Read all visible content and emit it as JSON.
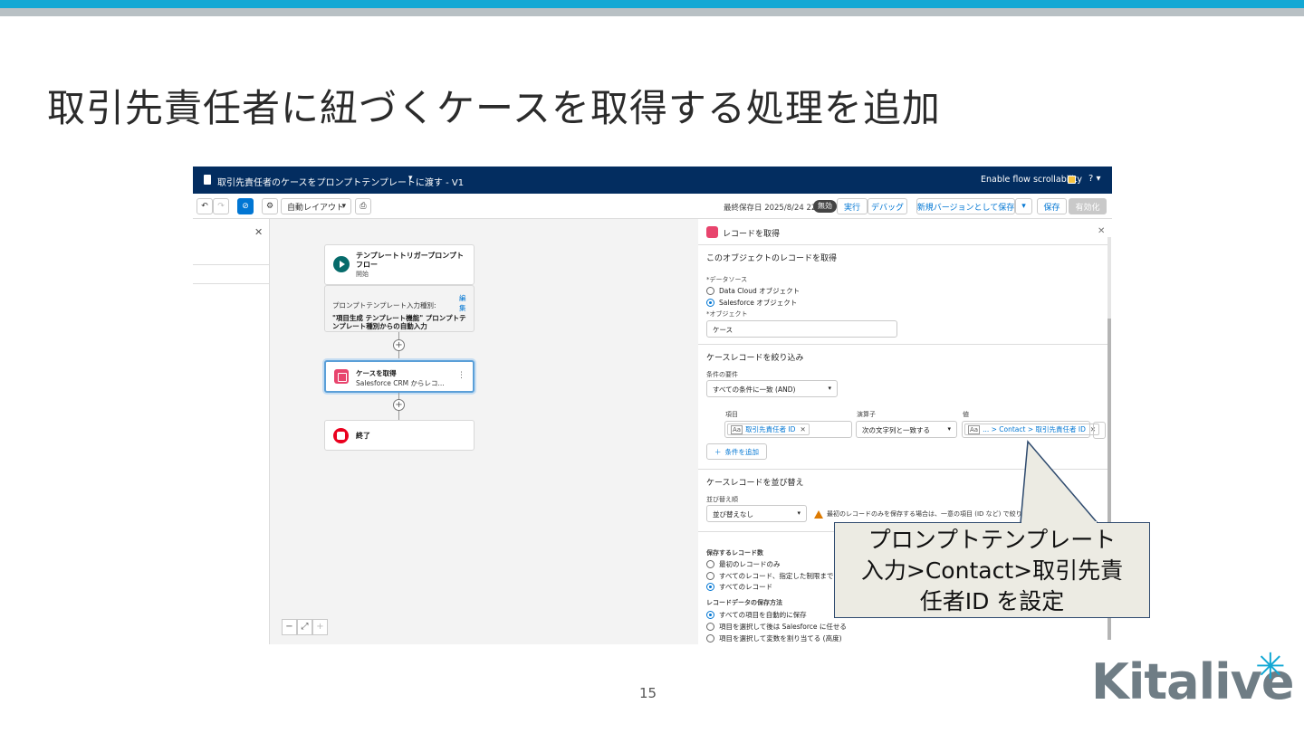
{
  "slide": {
    "title": "取引先責任者に紐づくケースを取得する処理を追加",
    "page_number": "15",
    "logo_text": "Kitalive",
    "accent_color": "#12a8d4",
    "callout_lines": [
      "プロンプトテンプレート",
      "入力>Contact>取引先責",
      "任者ID を設定"
    ]
  },
  "app_header": {
    "flow_title": "取引先責任者のケースをプロンプトテンプレートに渡す - V1",
    "scroll_toggle_label": "Enable flow scrollability",
    "help": "?",
    "brand_color": "#032d60"
  },
  "toolbar": {
    "undo": "↶",
    "redo": "↷",
    "auto_layout_label": "自動レイアウト",
    "last_saved": "最終保存日 2025/8/24 22:41",
    "status_badge": "無効",
    "run": "実行",
    "debug": "デバッグ",
    "save_as_new": "新規バージョンとして保存",
    "save": "保存",
    "activate": "有効化"
  },
  "canvas": {
    "start_node_title": "テンプレートトリガープロンプトフロー",
    "start_node_subtitle": "開始",
    "start_input_label": "プロンプトテンプレート入力種別:",
    "start_input_edit": "編集",
    "start_input_value": "\"項目生成 テンプレート機能\" プロンプトテンプレート種別からの自動入力",
    "get_node_title": "ケースを取得",
    "get_node_subtitle": "Salesforce CRM からレコ...",
    "end_node_title": "終了"
  },
  "panel": {
    "title": "レコードを取得",
    "section_get": "このオブジェクトのレコードを取得",
    "data_source_label": "*データソース",
    "ds_option_1": "Data Cloud オブジェクト",
    "ds_option_2": "Salesforce オブジェクト",
    "object_label": "*オブジェクト",
    "object_value": "ケース",
    "section_filter": "ケースレコードを絞り込み",
    "condition_req_label": "条件の要件",
    "condition_req_value": "すべての条件に一致 (AND)",
    "col_field": "項目",
    "col_operator": "演算子",
    "col_value": "値",
    "field_value": "取引先責任者 ID",
    "operator_value": "次の文字列と一致する",
    "value_value": "... > Contact > 取引先責任者 ID",
    "add_condition": "条件を追加",
    "section_sort": "ケースレコードを並び替え",
    "sort_label": "並び替え順",
    "sort_value": "並び替えなし",
    "sort_warning": "最初のレコードのみを保存する場合は、一意の項目 (ID など) で絞り込",
    "count_label": "保存するレコード数",
    "count_opt_1": "最初のレコードのみ",
    "count_opt_2": "すべてのレコード、指定した制限まで",
    "count_opt_3": "すべてのレコード",
    "store_label": "レコードデータの保存方法",
    "store_opt_1": "すべての項目を自動的に保存",
    "store_opt_2": "項目を選択して後は Salesforce に任せる",
    "store_opt_3": "項目を選択して変数を割り当てる (高度)"
  }
}
